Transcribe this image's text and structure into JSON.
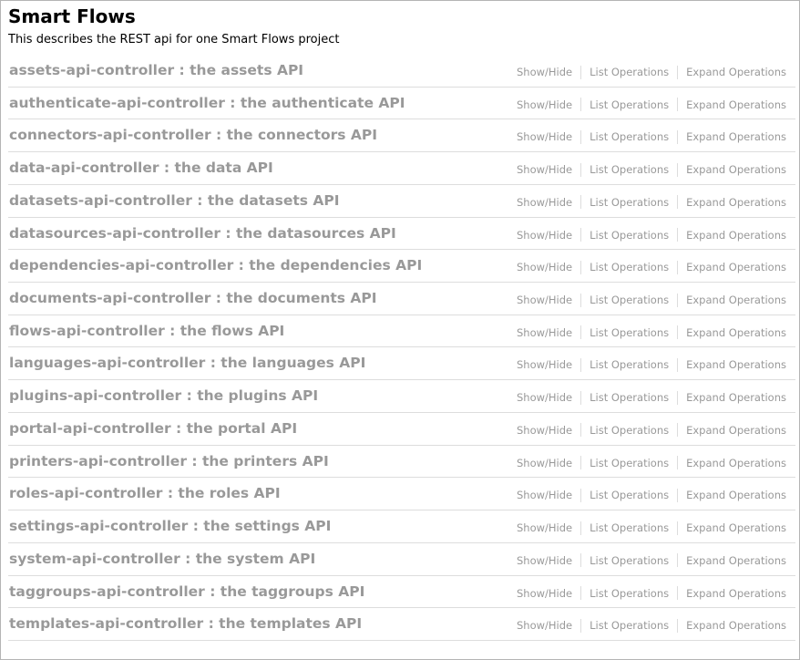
{
  "header": {
    "title": "Smart Flows",
    "description": "This describes the REST api for one Smart Flows project"
  },
  "operation_links": {
    "show_hide": "Show/Hide",
    "list_operations": "List Operations",
    "expand_operations": "Expand Operations"
  },
  "resources": [
    {
      "label": "assets-api-controller : the assets API"
    },
    {
      "label": "authenticate-api-controller : the authenticate API"
    },
    {
      "label": "connectors-api-controller : the connectors API"
    },
    {
      "label": "data-api-controller : the data API"
    },
    {
      "label": "datasets-api-controller : the datasets API"
    },
    {
      "label": "datasources-api-controller : the datasources API"
    },
    {
      "label": "dependencies-api-controller : the dependencies API"
    },
    {
      "label": "documents-api-controller : the documents API"
    },
    {
      "label": "flows-api-controller : the flows API"
    },
    {
      "label": "languages-api-controller : the languages API"
    },
    {
      "label": "plugins-api-controller : the plugins API"
    },
    {
      "label": "portal-api-controller : the portal API"
    },
    {
      "label": "printers-api-controller : the printers API"
    },
    {
      "label": "roles-api-controller : the roles API"
    },
    {
      "label": "settings-api-controller : the settings API"
    },
    {
      "label": "system-api-controller : the system API"
    },
    {
      "label": "taggroups-api-controller : the taggroups API"
    },
    {
      "label": "templates-api-controller : the templates API"
    }
  ],
  "colors": {
    "heading_text": "#999999",
    "link_text": "#999999",
    "divider": "#dddddd",
    "border": "#b5b5b5"
  }
}
